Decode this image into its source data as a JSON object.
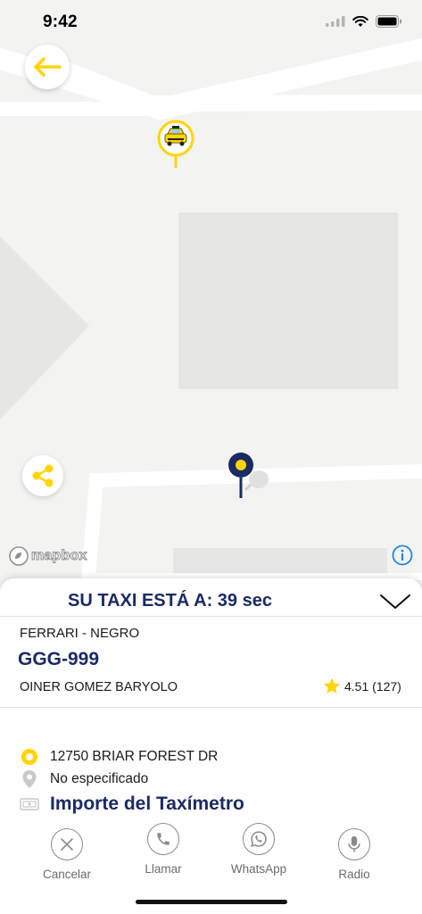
{
  "status_bar": {
    "time": "9:42"
  },
  "map": {
    "attribution": "mapbox"
  },
  "sheet": {
    "eta": "SU TAXI ESTÁ A: 39 sec",
    "car_model": "FERRARI - NEGRO",
    "plate": "GGG-999",
    "driver_name": "OINER GOMEZ BARYOLO",
    "rating": "4.51 (127)",
    "pickup_address": "12750 BRIAR FOREST DR",
    "destination": "No especificado",
    "fare_label": "Importe del Taxímetro"
  },
  "actions": [
    {
      "label": "Cancelar",
      "icon": "close-icon"
    },
    {
      "label": "Llamar",
      "icon": "phone-icon"
    },
    {
      "label": "WhatsApp",
      "icon": "whatsapp-icon"
    },
    {
      "label": "Radio",
      "icon": "microphone-icon"
    }
  ],
  "colors": {
    "accent_yellow": "#FFD500",
    "navy": "#1B2A63",
    "map_bg": "#F3F3F2",
    "info_blue": "#1E88E5"
  }
}
